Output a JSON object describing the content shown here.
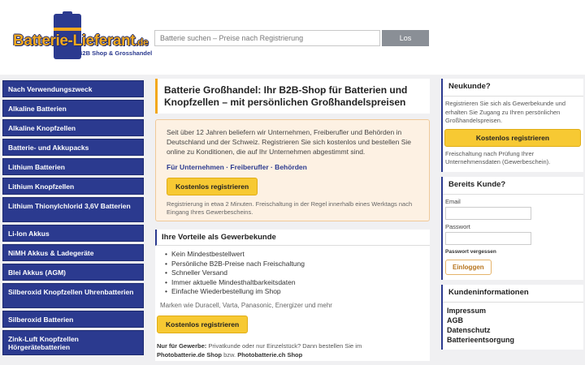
{
  "header": {
    "logo_text": "Batterie-Lieferant",
    "logo_tld": ".de",
    "logo_tagline": "B2B Shop & Grosshandel",
    "search_placeholder": "Batterie suchen – Preise nach Registrierung",
    "search_button": "Los"
  },
  "sidebar": {
    "items": [
      {
        "label": "Nach Verwendungszweck"
      },
      {
        "label": "Alkaline Batterien"
      },
      {
        "label": "Alkaline Knopfzellen"
      },
      {
        "label": "Batterie- und Akkupacks"
      },
      {
        "label": "Lithium Batterien"
      },
      {
        "label": "Lithium Knopfzellen"
      },
      {
        "label": "Lithium Thionylchlorid 3,6V Batterien"
      },
      {
        "label": "Li-Ion Akkus"
      },
      {
        "label": "NiMH Akkus & Ladegeräte"
      },
      {
        "label": "Blei Akkus (AGM)"
      },
      {
        "label": "Silberoxid Knopfzellen Uhrenbatterien"
      },
      {
        "label": "Silberoxid Batterien"
      },
      {
        "label": "Zink-Luft Knopfzellen Hörgerätebatterien"
      }
    ]
  },
  "main": {
    "title": "Batterie Großhandel: Ihr B2B-Shop für Batterien und Knopfzellen – mit persönlichen Großhandelspreisen",
    "intro_text": "Seit über 12 Jahren beliefern wir Unternehmen, Freiberufler und Behörden in Deutschland und der Schweiz. Registrieren Sie sich kostenlos und bestellen Sie online zu Konditionen, die auf Ihr Unternehmen abgestimmt sind.",
    "intro_links": "Für Unternehmen · Freiberufler · Behörden",
    "intro_button": "Kostenlos registrieren",
    "intro_note": "Registrierung in etwa 2 Minuten. Freischaltung in der Regel innerhalb eines Werktags nach Eingang Ihres Gewerbescheins.",
    "benefits_title": "Ihre Vorteile als Gewerbekunde",
    "benefits": [
      "Kein Mindestbestellwert",
      "Persönliche B2B-Preise nach Freischaltung",
      "Schneller Versand",
      "Immer aktuelle Mindesthaltbarkeitsdaten",
      "Einfache Wiederbestellung im Shop"
    ],
    "brands": "Marken wie Duracell, Varta, Panasonic, Energizer und mehr",
    "benefits_button": "Kostenlos registrieren",
    "footer_lead": "Nur für Gewerbe:",
    "footer_text": "Privatkunde oder nur Einzelstück? Dann bestellen Sie im",
    "footer_shop1": "Photobatterie.de Shop",
    "footer_sep": "bzw.",
    "footer_shop2": "Photobatterie.ch Shop"
  },
  "right": {
    "new_title": "Neukunde?",
    "new_text": "Registrieren Sie sich als Gewerbekunde und erhalten Sie Zugang zu Ihren persönlichen Großhandelspreisen.",
    "new_button": "Kostenlos registrieren",
    "new_note": "Freischaltung nach Prüfung Ihrer Unternehmensdaten (Gewerbeschein).",
    "login_title": "Bereits Kunde?",
    "email_label": "Email",
    "password_label": "Passwort",
    "forgot": "Passwort vergessen",
    "login_button": "Einloggen",
    "info_title": "Kundeninformationen",
    "info_links": [
      "Impressum",
      "AGB",
      "Datenschutz",
      "Batterieentsorgung"
    ]
  },
  "colors": {
    "brand_blue": "#2b3a8f",
    "brand_orange": "#f2a81d",
    "button_yellow": "#f7c933"
  }
}
